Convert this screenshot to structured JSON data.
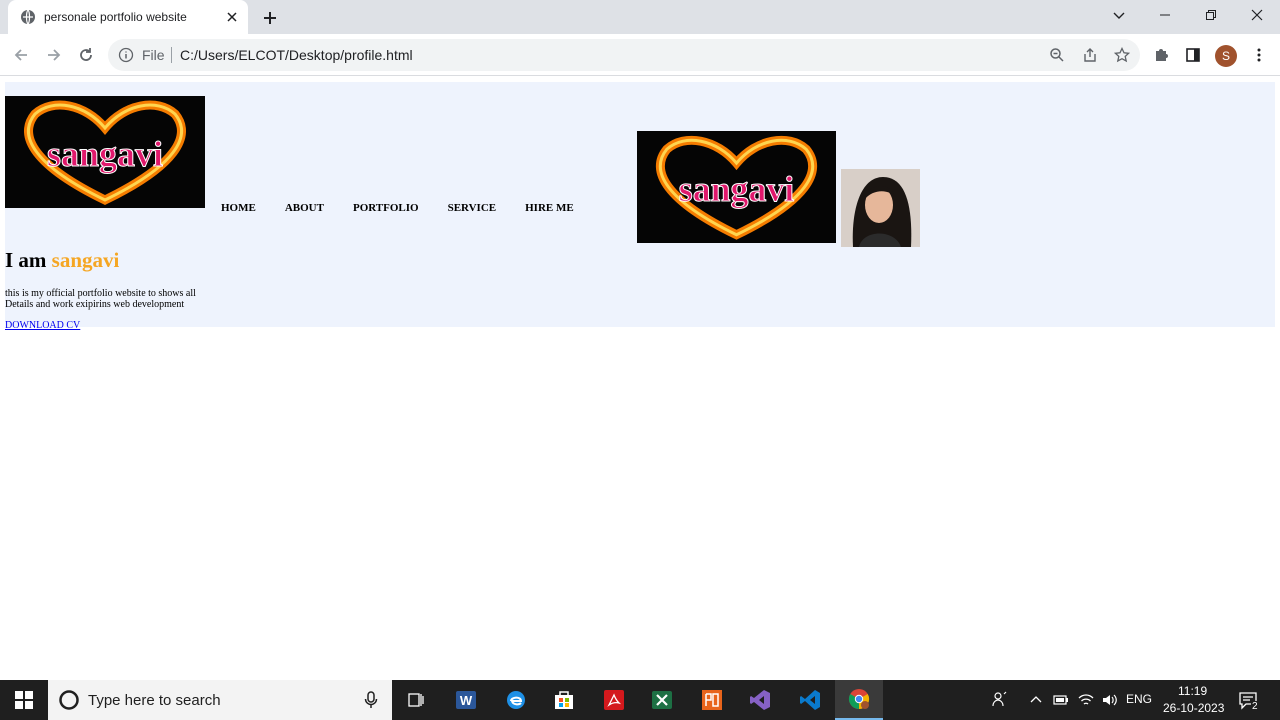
{
  "browser": {
    "tab_title": "personale portfolio website",
    "url_scheme": "File",
    "url": "C:/Users/ELCOT/Desktop/profile.html",
    "profile_initial": "S"
  },
  "site": {
    "logo_text": "sangavi",
    "nav": [
      "HOME",
      "ABOUT",
      "PORTFOLIO",
      "SERVICE",
      "HIRE ME"
    ],
    "heading_prefix": "I am ",
    "heading_name": "sangavi",
    "description_line1": "this is my official portfolio website to shows all",
    "description_line2": "Details and work exipirins web development",
    "cv_link": "DOWNLOAD CV"
  },
  "taskbar": {
    "search_placeholder": "Type here to search",
    "language": "ENG",
    "time": "11:19",
    "date": "26-10-2023",
    "notification_count": "2"
  },
  "colors": {
    "hero_bg": "#eef3fd",
    "accent_name": "#f5a623",
    "link": "#0000ee"
  }
}
